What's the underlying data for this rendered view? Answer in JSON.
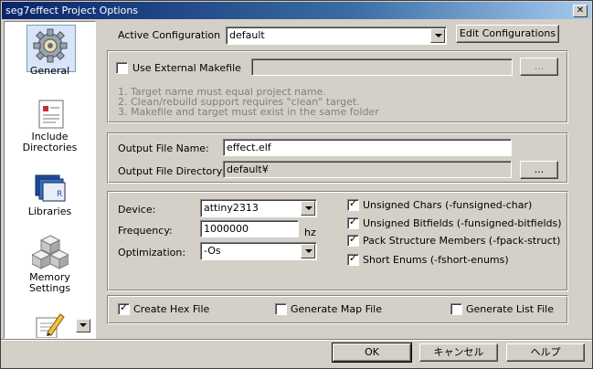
{
  "window": {
    "title": "seg7effect Project Options",
    "close_symbol": "✕"
  },
  "sidebar": {
    "items": [
      {
        "label": "General",
        "icon": "gear-icon"
      },
      {
        "label": "Include Directories",
        "label_line1": "Include",
        "label_line2": "Directories",
        "icon": "include-directories-icon"
      },
      {
        "label": "Libraries",
        "icon": "libraries-icon"
      },
      {
        "label": "Memory Settings",
        "label_line1": "Memory",
        "label_line2": "Settings",
        "icon": "memory-settings-icon"
      },
      {
        "label": "",
        "icon": "pencil-icon"
      }
    ]
  },
  "active_config": {
    "label": "Active Configuration",
    "value": "default",
    "edit_button": "Edit Configurations"
  },
  "makefile": {
    "use_label": "Use External Makefile",
    "checked": false,
    "browse_label": "...",
    "notes": [
      "1. Target name must equal project name.",
      "2. Clean/rebuild support requires \"clean\" target.",
      "3. Makefile and target must exist in the same folder"
    ]
  },
  "output": {
    "file_name_label": "Output File Name:",
    "file_name_value": "effect.elf",
    "dir_label": "Output File Directory:",
    "dir_value": "default¥",
    "browse_label": "..."
  },
  "device": {
    "device_label": "Device:",
    "device_value": "attiny2313",
    "frequency_label": "Frequency:",
    "frequency_value": "1000000",
    "frequency_unit": "hz",
    "optimization_label": "Optimization:",
    "optimization_value": "-Os",
    "options": [
      {
        "label": "Unsigned Chars (-funsigned-char)",
        "checked": true
      },
      {
        "label": "Unsigned Bitfields (-funsigned-bitfields)",
        "checked": true
      },
      {
        "label": "Pack Structure Members (-fpack-struct)",
        "checked": true
      },
      {
        "label": "Short Enums (-fshort-enums)",
        "checked": true
      }
    ]
  },
  "outputs": {
    "hex_label": "Create Hex File",
    "hex_checked": true,
    "map_label": "Generate Map File",
    "map_checked": false,
    "list_label": "Generate List File",
    "list_checked": false
  },
  "footer": {
    "ok": "OK",
    "cancel": "キャンセル",
    "help": "ヘルプ"
  },
  "colors": {
    "title_start": "#0a246a",
    "title_end": "#a6caf0",
    "face": "#d4d0c8"
  }
}
